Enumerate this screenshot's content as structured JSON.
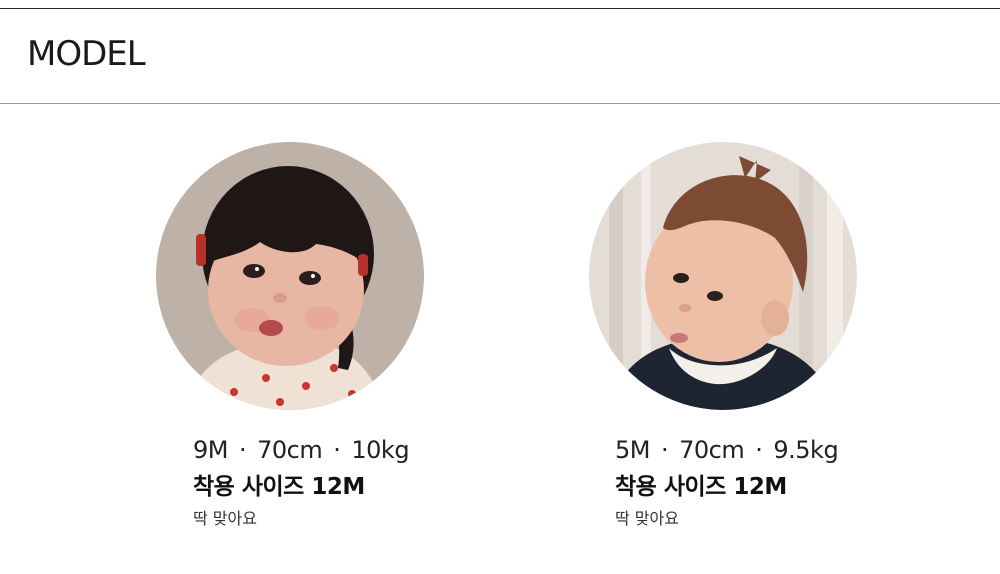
{
  "section": {
    "title": "MODEL"
  },
  "models": [
    {
      "age": "9M",
      "height": "70cm",
      "weight": "10kg",
      "separator": "·",
      "size_label": "착용 사이즈 12M",
      "fit_note": "딱 맞아요"
    },
    {
      "age": "5M",
      "height": "70cm",
      "weight": "9.5kg",
      "separator": "·",
      "size_label": "착용 사이즈 12M",
      "fit_note": "딱 맞아요"
    }
  ]
}
